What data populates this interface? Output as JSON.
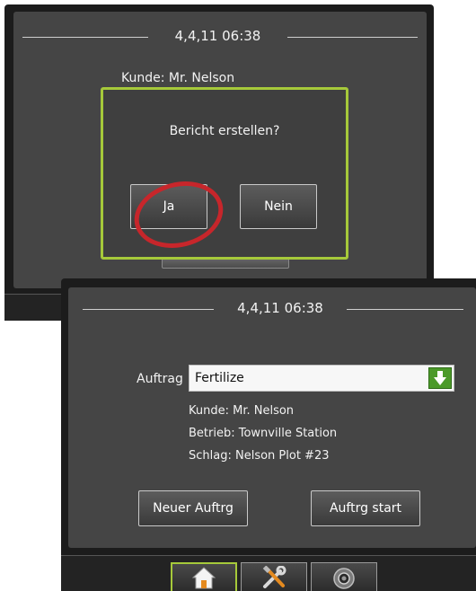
{
  "dialog_screen": {
    "datetime": "4,4,11 06:38",
    "kunde_label": "Kunde:",
    "kunde_value": "Mr. Nelson",
    "question": "Bericht erstellen?",
    "yes_label": "Ja",
    "no_label": "Nein"
  },
  "job_screen": {
    "datetime": "4,4,11 06:38",
    "auftrag_label": "Auftrag",
    "auftrag_value": "Fertilize",
    "kunde": "Kunde: Mr. Nelson",
    "betrieb": "Betrieb: Townville Station",
    "schlag": "Schlag: Nelson Plot #23",
    "new_job_label": "Neuer Auftrg",
    "start_job_label": "Auftrg start"
  },
  "tabs": [
    {
      "icon": "home-icon",
      "active": true
    },
    {
      "icon": "tools-icon",
      "active": false
    },
    {
      "icon": "camera-icon",
      "active": false
    }
  ],
  "colors": {
    "accent_green": "#a6c93a",
    "highlight_red": "#c7262b",
    "dropdown_arrow": "#4c9a2a"
  }
}
